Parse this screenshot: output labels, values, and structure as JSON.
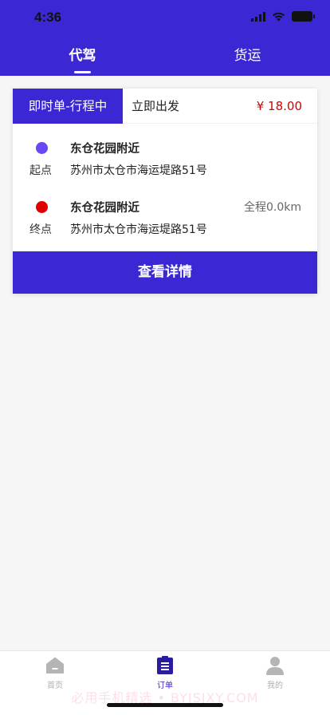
{
  "status_bar": {
    "time": "4:36"
  },
  "tabs": [
    {
      "label": "代驾",
      "active": true
    },
    {
      "label": "货运",
      "active": false
    }
  ],
  "order": {
    "type_label": "即时单-行程中",
    "depart_label": "立即出发",
    "price": "¥ 18.00",
    "start": {
      "label": "起点",
      "place": "东仓花园附近",
      "address": "苏州市太仓市海运堤路51号"
    },
    "end": {
      "label": "终点",
      "place": "东仓花园附近",
      "address": "苏州市太仓市海运堤路51号",
      "distance": "全程0.0km"
    },
    "detail_button": "查看详情"
  },
  "tabbar": {
    "items": [
      {
        "label": "首页",
        "icon": "home-icon",
        "active": false
      },
      {
        "label": "订单",
        "icon": "clipboard-icon",
        "active": true
      },
      {
        "label": "我的",
        "icon": "person-icon",
        "active": false
      }
    ]
  },
  "watermark": "必用手机精选 • BYJSJXY.COM",
  "colors": {
    "brand": "#3b28d4",
    "price": "#d40000",
    "start_dot": "#6a47f5",
    "end_dot": "#e00000"
  }
}
